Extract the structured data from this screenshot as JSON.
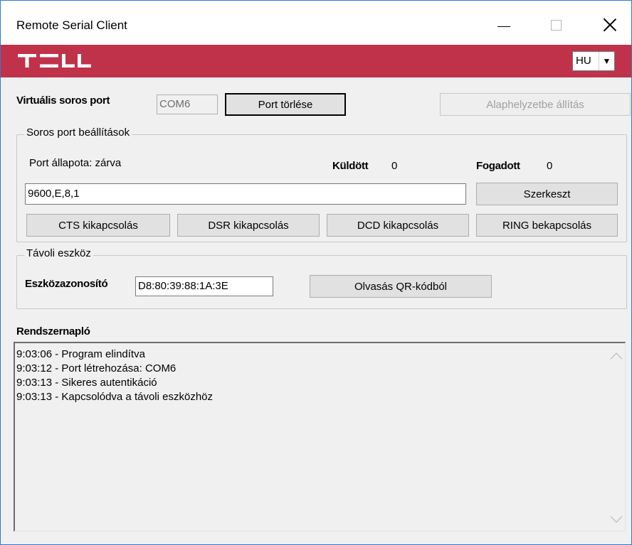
{
  "window": {
    "title": "Remote Serial Client"
  },
  "brand": {
    "logo_text": "TELL",
    "color": "#c0314a",
    "language": "HU"
  },
  "virtual_port": {
    "label": "Virtuális soros port",
    "value": "COM6",
    "delete_button": "Port törlése",
    "reset_button": "Alaphelyzetbe állítás"
  },
  "serial_settings": {
    "title": "Soros port beállítások",
    "status_label": "Port állapota: zárva",
    "sent_label": "Küldött",
    "sent_value": "0",
    "received_label": "Fogadott",
    "received_value": "0",
    "config_value": "9600,E,8,1",
    "edit_button": "Szerkeszt",
    "cts_button": "CTS kikapcsolás",
    "dsr_button": "DSR kikapcsolás",
    "dcd_button": "DCD kikapcsolás",
    "ring_button": "RING bekapcsolás"
  },
  "remote_device": {
    "title": "Távoli eszköz",
    "id_label": "Eszközazonosító",
    "id_value": "D8:80:39:88:1A:3E",
    "qr_button": "Olvasás QR-kódból"
  },
  "system_log": {
    "title": "Rendszernapló",
    "lines": [
      "9:03:06 - Program elindítva",
      "9:03:12 - Port létrehozása: COM6",
      "9:03:13 - Sikeres autentikáció",
      "9:03:13 - Kapcsolódva a távoli eszközhöz"
    ]
  }
}
